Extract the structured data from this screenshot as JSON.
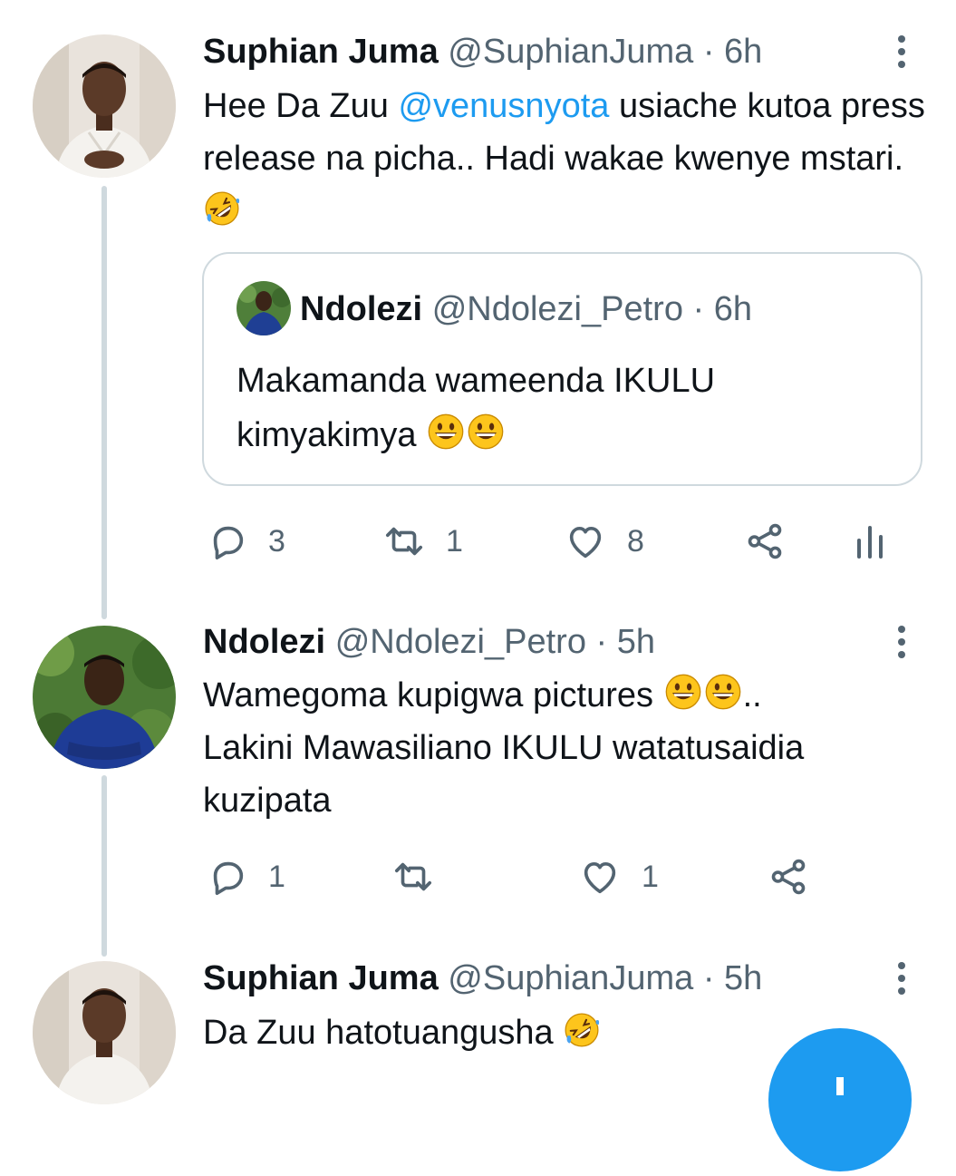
{
  "colors": {
    "accent": "#1d9bf0",
    "muted": "#536471",
    "text": "#0f1419",
    "thread_line": "#cfd9de"
  },
  "tweets": [
    {
      "author_name": "Suphian Juma",
      "handle": "@SuphianJuma",
      "time": "· 6h",
      "text_before": "Hee Da Zuu ",
      "mention": "@venusnyota",
      "text_after": " usiache kutoa press release na picha.. Hadi wakae kwenye mstari. ",
      "emoji": "rolling-on-floor-laughing",
      "quote": {
        "author_name": "Ndolezi",
        "handle": "@Ndolezi_Petro",
        "time": "· 6h",
        "text": "Makamanda wameenda IKULU kimyakimya ",
        "emoji": "grinning-face"
      },
      "actions": {
        "replies": "3",
        "retweets": "1",
        "likes": "8"
      }
    },
    {
      "author_name": "Ndolezi",
      "handle": "@Ndolezi_Petro",
      "time": "· 5h",
      "text_part1": "Wamegoma kupigwa pictures ",
      "text_part2": "..",
      "text_part3": "Lakini Mawasiliano IKULU watatusaidia kuzipata",
      "emoji": "grinning-face",
      "actions": {
        "replies": "1",
        "retweets": "",
        "likes": "1"
      }
    },
    {
      "author_name": "Suphian Juma",
      "handle": "@SuphianJuma",
      "time": "· 5h",
      "text": "Da Zuu hatotuangusha ",
      "emoji": "rolling-on-floor-laughing"
    }
  ],
  "fab": {
    "icon": "compose-plus-icon"
  }
}
